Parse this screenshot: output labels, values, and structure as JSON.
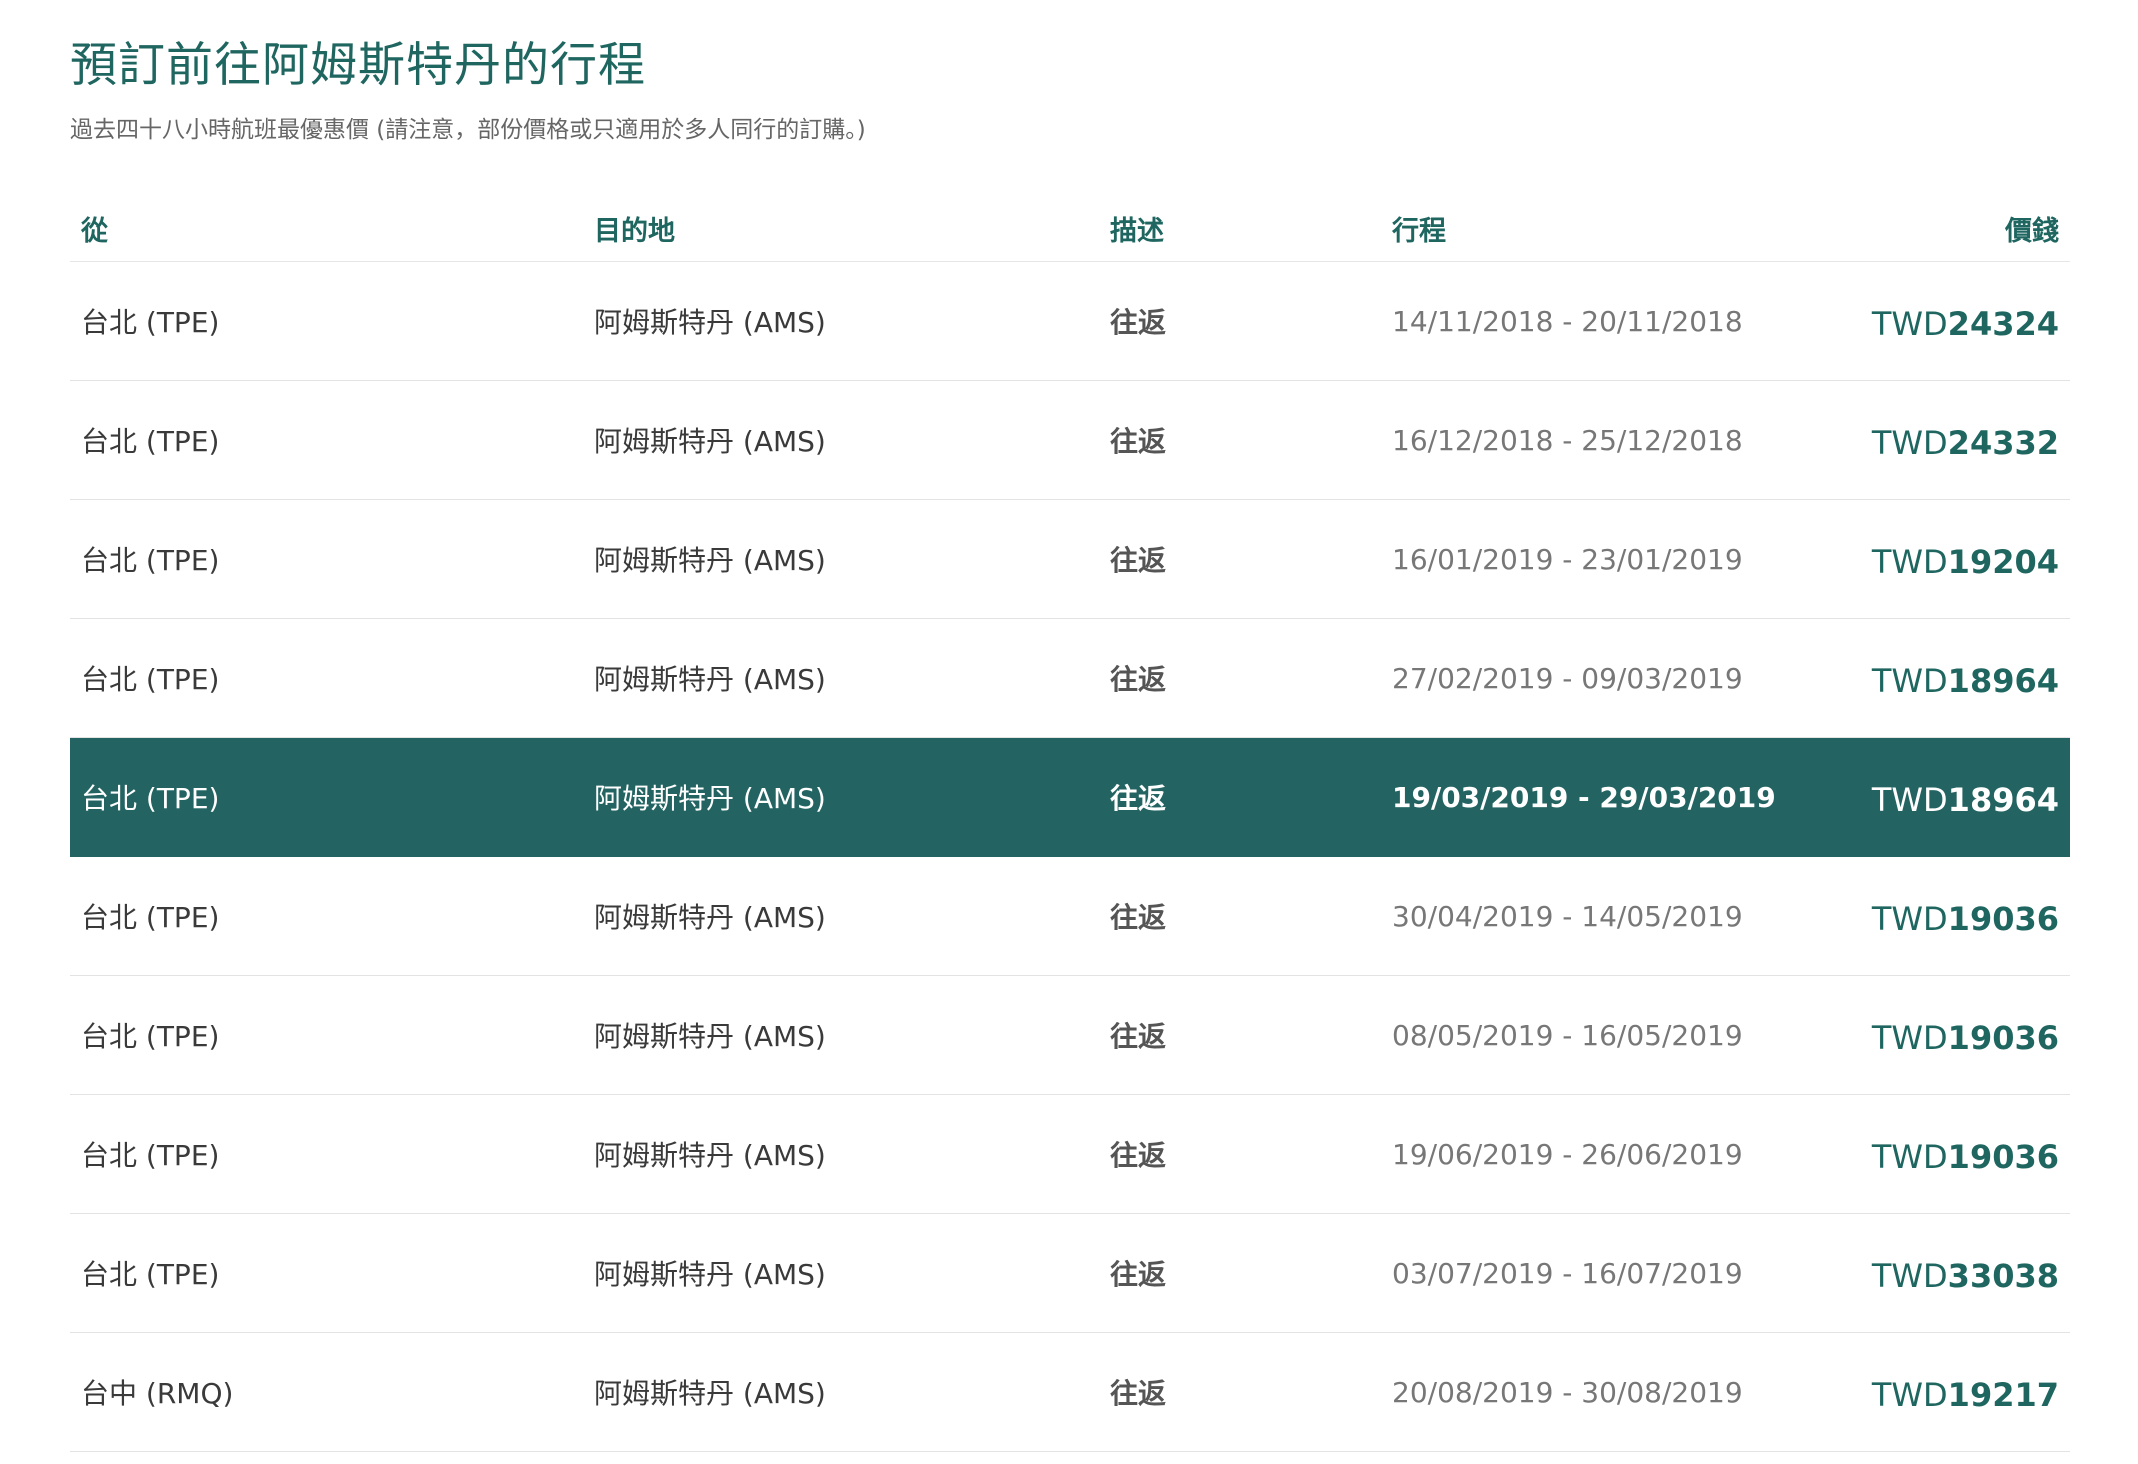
{
  "page": {
    "title": "預訂前往阿姆斯特丹的行程",
    "subtitle": "過去四十八小時航班最優惠價 (請注意，部份價格或只適用於多人同行的訂購。)"
  },
  "table": {
    "headers": {
      "from": "從",
      "destination": "目的地",
      "description": "描述",
      "trip": "行程",
      "price": "價錢"
    },
    "rows": [
      {
        "from": "台北 (TPE)",
        "destination": "阿姆斯特丹 (AMS)",
        "description": "往返",
        "dates": "14/11/2018 - 20/11/2018",
        "currency": "TWD",
        "amount": "24324"
      },
      {
        "from": "台北 (TPE)",
        "destination": "阿姆斯特丹 (AMS)",
        "description": "往返",
        "dates": "16/12/2018 - 25/12/2018",
        "currency": "TWD",
        "amount": "24332"
      },
      {
        "from": "台北 (TPE)",
        "destination": "阿姆斯特丹 (AMS)",
        "description": "往返",
        "dates": "16/01/2019 - 23/01/2019",
        "currency": "TWD",
        "amount": "19204"
      },
      {
        "from": "台北 (TPE)",
        "destination": "阿姆斯特丹 (AMS)",
        "description": "往返",
        "dates": "27/02/2019 - 09/03/2019",
        "currency": "TWD",
        "amount": "18964"
      },
      {
        "from": "台北 (TPE)",
        "destination": "阿姆斯特丹 (AMS)",
        "description": "往返",
        "dates": "19/03/2019 - 29/03/2019",
        "currency": "TWD",
        "amount": "18964"
      },
      {
        "from": "台北 (TPE)",
        "destination": "阿姆斯特丹 (AMS)",
        "description": "往返",
        "dates": "30/04/2019 - 14/05/2019",
        "currency": "TWD",
        "amount": "19036"
      },
      {
        "from": "台北 (TPE)",
        "destination": "阿姆斯特丹 (AMS)",
        "description": "往返",
        "dates": "08/05/2019 - 16/05/2019",
        "currency": "TWD",
        "amount": "19036"
      },
      {
        "from": "台北 (TPE)",
        "destination": "阿姆斯特丹 (AMS)",
        "description": "往返",
        "dates": "19/06/2019 - 26/06/2019",
        "currency": "TWD",
        "amount": "19036"
      },
      {
        "from": "台北 (TPE)",
        "destination": "阿姆斯特丹 (AMS)",
        "description": "往返",
        "dates": "03/07/2019 - 16/07/2019",
        "currency": "TWD",
        "amount": "33038"
      },
      {
        "from": "台中 (RMQ)",
        "destination": "阿姆斯特丹 (AMS)",
        "description": "往返",
        "dates": "20/08/2019 - 30/08/2019",
        "currency": "TWD",
        "amount": "19217"
      }
    ]
  },
  "colors": {
    "accent": "#1f6660",
    "highlight_row": "#236462"
  }
}
